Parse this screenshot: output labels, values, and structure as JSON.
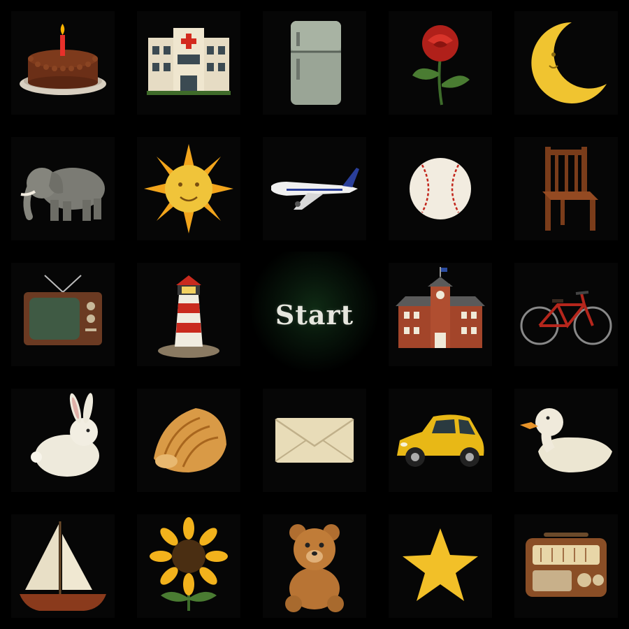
{
  "start": {
    "label": "Start"
  },
  "tiles": [
    {
      "icon": "cake-icon"
    },
    {
      "icon": "hospital-icon"
    },
    {
      "icon": "refrigerator-icon"
    },
    {
      "icon": "rose-icon"
    },
    {
      "icon": "crescent-moon-icon"
    },
    {
      "icon": "elephant-icon"
    },
    {
      "icon": "sun-icon"
    },
    {
      "icon": "airplane-icon"
    },
    {
      "icon": "baseball-icon"
    },
    {
      "icon": "chair-icon"
    },
    {
      "icon": "television-icon"
    },
    {
      "icon": "lighthouse-icon"
    },
    {
      "icon": "start"
    },
    {
      "icon": "school-icon"
    },
    {
      "icon": "bicycle-icon"
    },
    {
      "icon": "rabbit-icon"
    },
    {
      "icon": "seashell-icon"
    },
    {
      "icon": "envelope-icon"
    },
    {
      "icon": "car-icon"
    },
    {
      "icon": "duck-icon"
    },
    {
      "icon": "sailboat-icon"
    },
    {
      "icon": "sunflower-icon"
    },
    {
      "icon": "teddy-bear-icon"
    },
    {
      "icon": "star-icon"
    },
    {
      "icon": "radio-icon"
    }
  ],
  "colors": {
    "background": "#000000",
    "start_glow": "#0f2a14",
    "start_text": "#e6e6de"
  }
}
